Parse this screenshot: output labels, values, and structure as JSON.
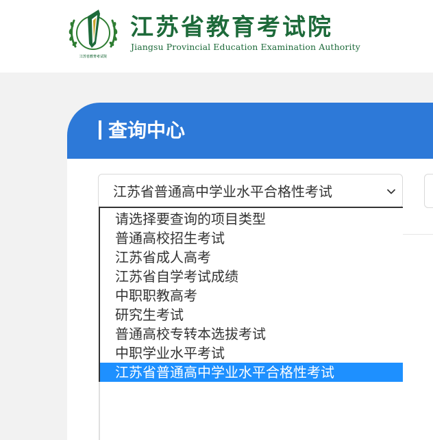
{
  "header": {
    "title": "江苏省教育考试院",
    "subtitle": "Jiangsu Provincial Education Examination Authority",
    "emblem_text": "江苏省教育考试院",
    "emblem_icon": "jsea-emblem-icon"
  },
  "panel": {
    "title": "查询中心"
  },
  "exam_select": {
    "value": "江苏省普通高中学业水平合格性考试",
    "chevron_icon": "chevron-down-icon",
    "options": [
      "请选择要查询的项目类型",
      "普通高校招生考试",
      "江苏省成人高考",
      "江苏省自学考试成绩",
      "中职职教高考",
      "研究生考试",
      "普通高校专转本选拔考试",
      "中职学业水平考试",
      "江苏省普通高中学业水平合格性考试"
    ],
    "selected_index": 8
  },
  "colors": {
    "brand_green": "#1d6a3a",
    "panel_blue": "#2d79d8",
    "highlight_blue": "#1e90ff"
  }
}
